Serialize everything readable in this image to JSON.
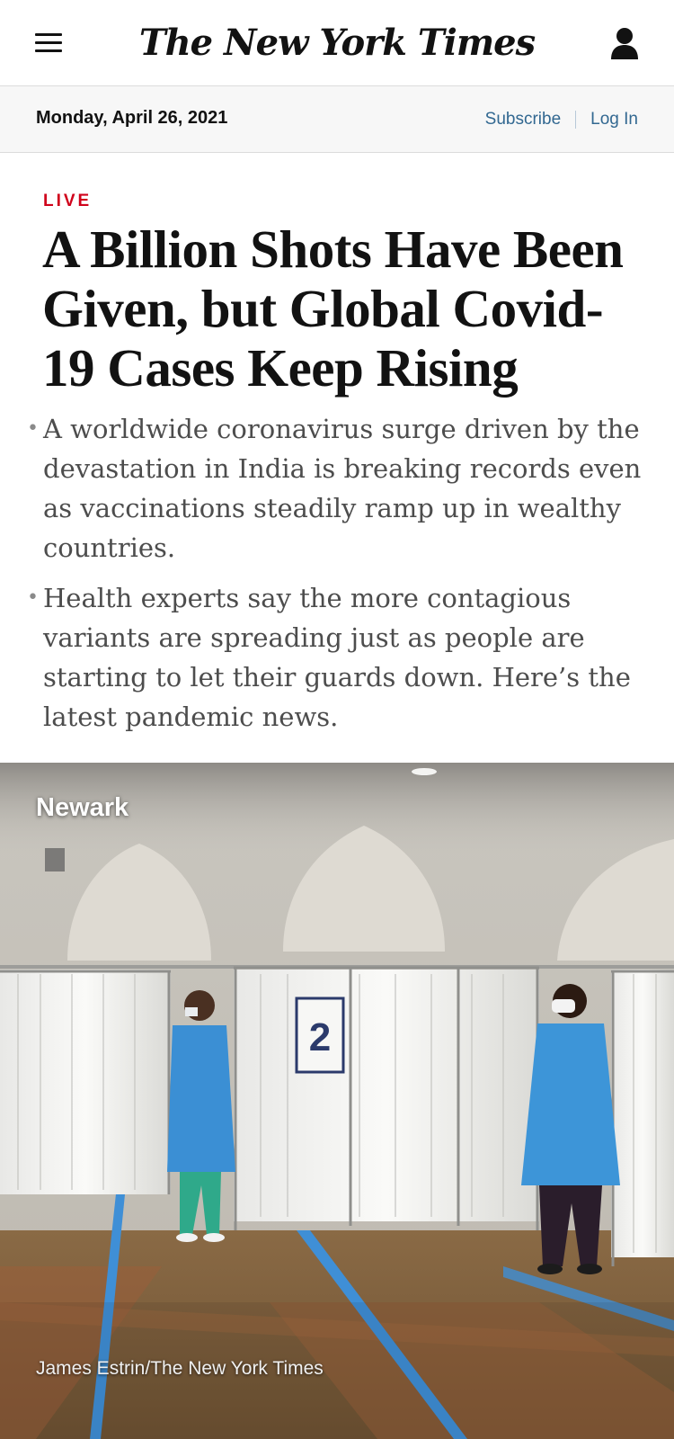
{
  "header": {
    "masthead": "The New York Times",
    "menu_icon": "hamburger-menu-icon",
    "account_icon": "account-icon"
  },
  "datebar": {
    "date": "Monday, April 26, 2021",
    "subscribe_label": "Subscribe",
    "login_label": "Log In"
  },
  "article": {
    "label": "LIVE",
    "headline": "A Billion Shots Have Been Given, but Global Covid-19 Cases Keep Rising",
    "summary": [
      "A worldwide coronavirus surge driven by the devastation in India is breaking records even as vaccinations steadily ramp up in wealthy countries.",
      "Health experts say the more contagious variants are spreading just as people are starting to let their guards down. Here’s the latest pandemic news."
    ]
  },
  "photo": {
    "location": "Newark",
    "booth_number": "2",
    "credit": "James Estrin/The New York Times"
  },
  "colors": {
    "live": "#d0021b",
    "link": "#326891",
    "text": "#121212",
    "summary_text": "#4d4d4d"
  }
}
